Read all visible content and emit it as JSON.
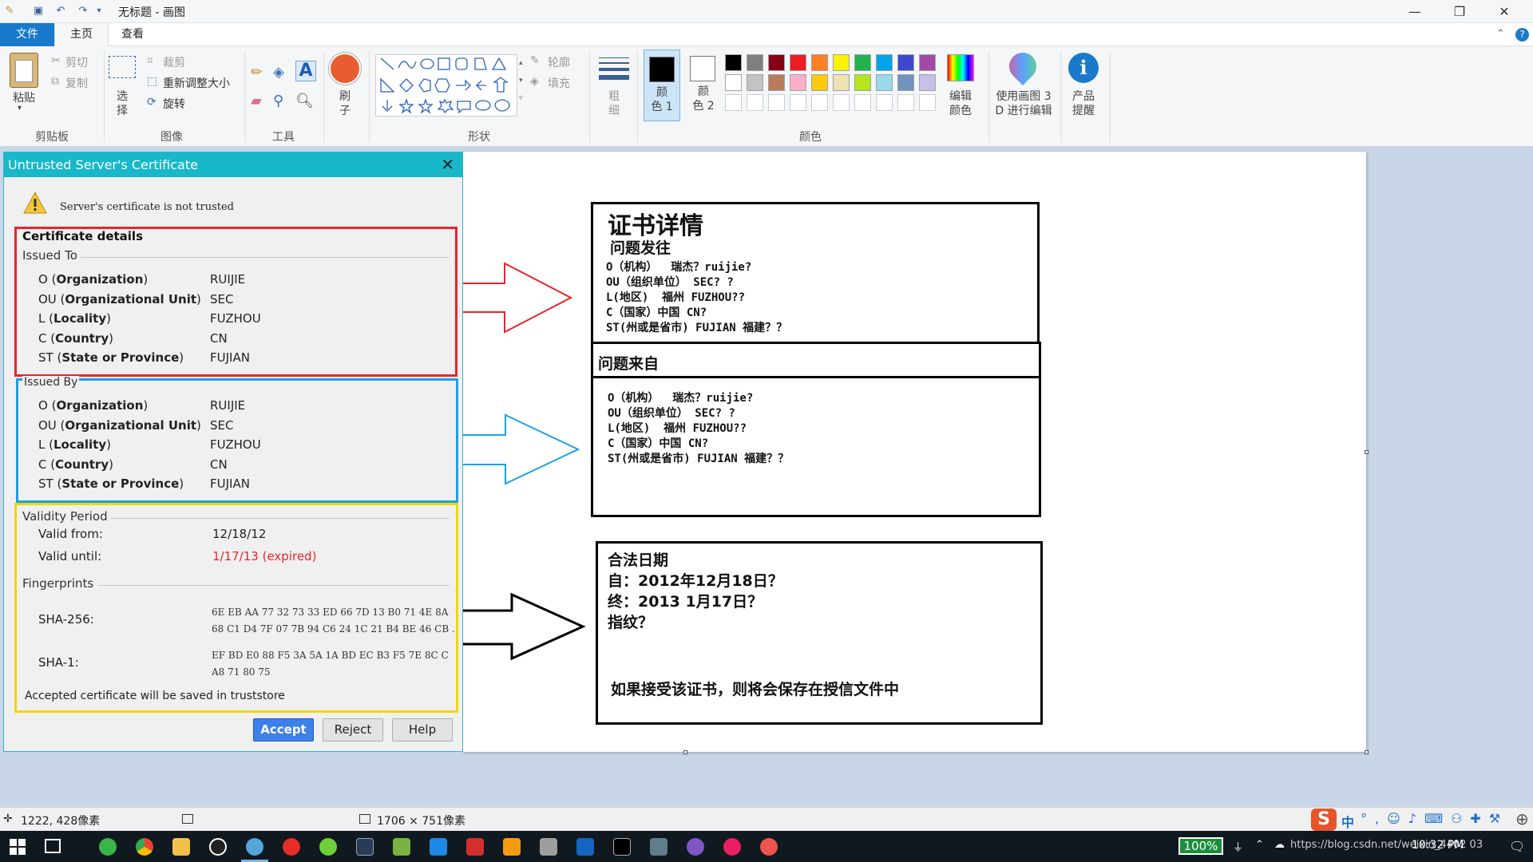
{
  "window": {
    "title": "无标题 - 画图",
    "controls": {
      "minimize": "—",
      "maximize": "❐",
      "close": "✕"
    }
  },
  "menu": {
    "file": "文件",
    "home": "主页",
    "view": "查看"
  },
  "ribbon": {
    "clipboard": {
      "paste": "粘贴",
      "cut": "剪切",
      "copy": "复制",
      "group": "剪贴板"
    },
    "image": {
      "select": "选\n择",
      "crop": "裁剪",
      "resize": "重新调整大小",
      "rotate": "旋转",
      "group": "图像"
    },
    "tools": {
      "group": "工具",
      "text_icon": "A"
    },
    "brush": {
      "label": "刷\n子"
    },
    "shapes": {
      "outline": "轮廓",
      "fill": "填充",
      "group": "形状"
    },
    "size": {
      "label": "粗\n细"
    },
    "colors": {
      "color1": "颜\n色 1",
      "color2": "颜\n色 2",
      "edit": "编辑\n颜色",
      "group": "颜色",
      "palette_row1": [
        "#000000",
        "#7f7f7f",
        "#880015",
        "#ed1c24",
        "#ff7f27",
        "#fff200",
        "#22b14c",
        "#00a2e8",
        "#3f48cc",
        "#a349a4"
      ],
      "palette_row2": [
        "#ffffff",
        "#c3c3c3",
        "#b97a57",
        "#ffaec9",
        "#ffc90e",
        "#efe4b0",
        "#b5e61d",
        "#99d9ea",
        "#7092be",
        "#c8bfe7"
      ]
    },
    "paint3d": {
      "label": "使用画图 3\nD 进行编辑"
    },
    "notice": {
      "label": "产品\n提醒"
    }
  },
  "dialog": {
    "title": "Untrusted Server's Certificate",
    "warning": "Server's certificate is not trusted",
    "details_header": "Certificate details",
    "issued_to": {
      "header": "Issued To",
      "rows": [
        {
          "pre": "O (",
          "key": "Organization",
          "post": ")",
          "value": "RUIJIE"
        },
        {
          "pre": "OU (",
          "key": "Organizational Unit",
          "post": ")",
          "value": "SEC"
        },
        {
          "pre": "L (",
          "key": "Locality",
          "post": ")",
          "value": "FUZHOU"
        },
        {
          "pre": "C (",
          "key": "Country",
          "post": ")",
          "value": "CN"
        },
        {
          "pre": "ST (",
          "key": "State or Province",
          "post": ")",
          "value": "FUJIAN"
        }
      ]
    },
    "issued_by": {
      "header": "Issued By",
      "rows": [
        {
          "pre": "O (",
          "key": "Organization",
          "post": ")",
          "value": "RUIJIE"
        },
        {
          "pre": "OU (",
          "key": "Organizational Unit",
          "post": ")",
          "value": "SEC"
        },
        {
          "pre": "L (",
          "key": "Locality",
          "post": ")",
          "value": "FUZHOU"
        },
        {
          "pre": "C (",
          "key": "Country",
          "post": ")",
          "value": "CN"
        },
        {
          "pre": "ST (",
          "key": "State or Province",
          "post": ")",
          "value": "FUJIAN"
        }
      ]
    },
    "validity": {
      "header": "Validity Period",
      "from_label": "Valid from:",
      "from_value": "12/18/12",
      "until_label": "Valid until:",
      "until_value": "1/17/13 (expired)"
    },
    "fingerprints": {
      "header": "Fingerprints",
      "sha256_label": "SHA-256:",
      "sha256_line1": "6E EB AA 77 32 73 33 ED 66 7D 13 B0 71 4E 8A",
      "sha256_line2": "68 C1 D4 7F 07 7B 94 C6 24 1C 21 B4 BE 46 CB .",
      "sha1_label": "SHA-1:",
      "sha1_line1": "EF BD E0 88 F5 3A 5A 1A BD EC B3 F5 7E 8C C",
      "sha1_line2": "A8 71 80 75"
    },
    "note": "Accepted certificate will be saved in truststore",
    "buttons": {
      "accept": "Accept",
      "reject": "Reject",
      "help": "Help"
    }
  },
  "annotations": {
    "box1": {
      "title": "证书详情",
      "subtitle": "问题发往",
      "lines": [
        "O（机构）  瑞杰？ruijie?",
        "OU（组织单位） SEC? ?",
        "L(地区)  福州 FUZHOU??",
        "C（国家）中国 CN?",
        "ST(州或是省市) FUJIAN 福建？？"
      ]
    },
    "box2": {
      "title": "问题来自",
      "lines": [
        "O（机构）  瑞杰？ruijie?",
        "OU（组织单位） SEC? ?",
        "L(地区)  福州 FUZHOU??",
        "C（国家）中国 CN?",
        "ST(州或是省市) FUJIAN 福建？？"
      ]
    },
    "box3": {
      "title": "合法日期",
      "from": "自：2012年12月18日？",
      "until": "终：2013 1月17日？",
      "fingerprint": "指纹？",
      "note": "如果接受该证书，则将会保存在授信文件中"
    },
    "arrow_colors": {
      "red": "#e8242c",
      "blue": "#1aa0e6",
      "black": "#000000"
    }
  },
  "statusbar": {
    "cursor": "1222, 428像素",
    "canvas_size": "1706 × 751像素"
  },
  "taskbar": {
    "battery": "100%",
    "clock": "10:32 PM",
    "watermark": "https://blog.csdn.net/weixin_4402 03",
    "ime": "中"
  }
}
